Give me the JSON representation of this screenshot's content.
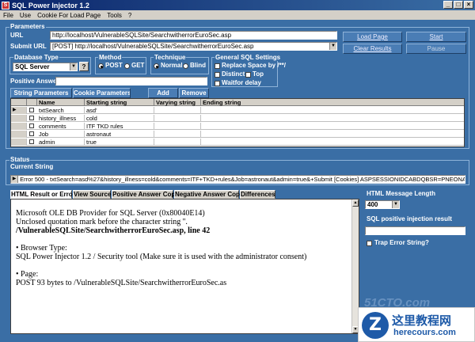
{
  "window": {
    "title": "SQL Power Injector 1.2"
  },
  "menu": [
    "File",
    "Use",
    "Cookie For Load Page",
    "Tools",
    "?"
  ],
  "parameters": {
    "group_label": "Parameters",
    "url_label": "URL",
    "url_value": "http://localhost/VulnerableSQLSite/SearchwitherrorEuroSec.asp",
    "submit_url_label": "Submit URL",
    "submit_url_value": "[POST] http://localhost/VulnerableSQLSite/SearchwitherrorEuroSec.asp",
    "load_page": "Load Page",
    "clear_results": "Clear Results",
    "start": "Start",
    "pause": "Pause"
  },
  "database_type": {
    "label": "Database Type",
    "value": "SQL Server",
    "help": "?"
  },
  "method": {
    "label": "Method",
    "options": [
      "POST",
      "GET"
    ],
    "selected": "POST"
  },
  "technique": {
    "label": "Technique",
    "options": [
      "Normal",
      "Blind"
    ],
    "selected": "Normal"
  },
  "general_sql": {
    "label": "General SQL Settings",
    "replace_space": "Replace Space by /**/",
    "distinct": "Distinct",
    "top": "Top",
    "waitfor": "Waitfor delay"
  },
  "positive_answer": {
    "label": "Positive Answer",
    "value": ""
  },
  "string_params": {
    "tab_string": "String Parameters",
    "tab_cookie": "Cookie Parameters",
    "add": "Add",
    "remove": "Remove",
    "columns": [
      "Name",
      "Starting string",
      "Varying string",
      "Ending string"
    ],
    "rows": [
      {
        "name": "txtSearch",
        "start": "asd'"
      },
      {
        "name": "history_illness",
        "start": "cold"
      },
      {
        "name": "comments",
        "start": "ITF TKD rules"
      },
      {
        "name": "Job",
        "start": "astronaut"
      },
      {
        "name": "admin",
        "start": "true"
      }
    ]
  },
  "status": {
    "group_label": "Status",
    "current_label": "Current String",
    "current_value": "Error 500 - txtSearch=asd%27&history_illness=cold&comments=ITF+TKD+rules&Job=astronaut&admin=true&+Submit [Cookies] ASPSESSIONIDCABDQBSR=PNEONAEBDA"
  },
  "result_tabs": [
    "HTML Result or Error",
    "View Source",
    "Positive Answer Copy",
    "Negative Answer Copy",
    "Differences"
  ],
  "result": {
    "l1": "Microsoft OLE DB Provider for SQL Server (0x80040E14)",
    "l2": "Unclosed quotation mark before the character string ''.",
    "l3": "/VulnerableSQLSite/SearchwitherrorEuroSec.asp, line 42",
    "l4": "•  Browser Type:",
    "l5": "SQL Power Injector 1.2 / Security tool (Make sure it is used with the administrator consent)",
    "l6": "•  Page:",
    "l7": "POST 93 bytes to /VulnerableSQLSite/SearchwitherrorEuroSec.as"
  },
  "side": {
    "html_len_label": "HTML Message Length",
    "html_len_value": "400",
    "sql_pos_label": "SQL positive injection result",
    "sql_pos_value": "",
    "trap_error": "Trap Error String?"
  },
  "watermark": {
    "top": "51CTO.com",
    "cn": "这里教程网",
    "site": "herecours.com",
    "logo": "Z"
  }
}
